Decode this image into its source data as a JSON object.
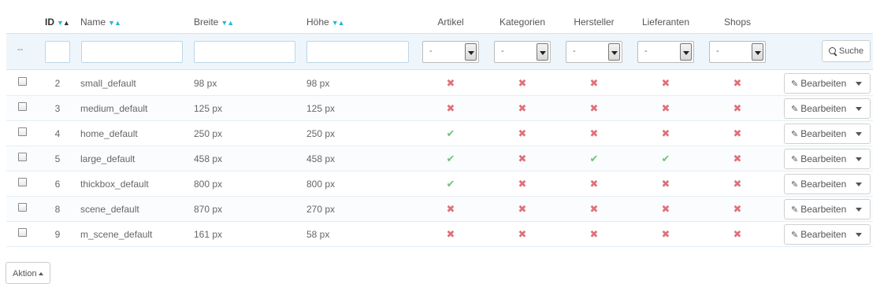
{
  "header": {
    "id": "ID",
    "name": "Name",
    "breite": "Breite",
    "hoehe": "Höhe",
    "artikel": "Artikel",
    "kategorien": "Kategorien",
    "hersteller": "Hersteller",
    "lieferanten": "Lieferanten",
    "shops": "Shops"
  },
  "filter": {
    "dash": "--",
    "select_value": "-",
    "search_label": "Suche"
  },
  "rows": [
    {
      "id": "2",
      "name": "small_default",
      "breite": "98 px",
      "hoehe": "98 px",
      "artikel": false,
      "kategorien": false,
      "hersteller": false,
      "lieferanten": false,
      "shops": false
    },
    {
      "id": "3",
      "name": "medium_default",
      "breite": "125 px",
      "hoehe": "125 px",
      "artikel": false,
      "kategorien": false,
      "hersteller": false,
      "lieferanten": false,
      "shops": false
    },
    {
      "id": "4",
      "name": "home_default",
      "breite": "250 px",
      "hoehe": "250 px",
      "artikel": true,
      "kategorien": false,
      "hersteller": false,
      "lieferanten": false,
      "shops": false
    },
    {
      "id": "5",
      "name": "large_default",
      "breite": "458 px",
      "hoehe": "458 px",
      "artikel": true,
      "kategorien": false,
      "hersteller": true,
      "lieferanten": true,
      "shops": false
    },
    {
      "id": "6",
      "name": "thickbox_default",
      "breite": "800 px",
      "hoehe": "800 px",
      "artikel": true,
      "kategorien": false,
      "hersteller": false,
      "lieferanten": false,
      "shops": false
    },
    {
      "id": "8",
      "name": "scene_default",
      "breite": "870 px",
      "hoehe": "270 px",
      "artikel": false,
      "kategorien": false,
      "hersteller": false,
      "lieferanten": false,
      "shops": false
    },
    {
      "id": "9",
      "name": "m_scene_default",
      "breite": "161 px",
      "hoehe": "58 px",
      "artikel": false,
      "kategorien": false,
      "hersteller": false,
      "lieferanten": false,
      "shops": false
    }
  ],
  "row_action": {
    "edit_label": "Bearbeiten"
  },
  "bulk": {
    "action_label": "Aktion"
  },
  "icons": {
    "yes": "check-icon",
    "no": "cross-icon"
  },
  "colors": {
    "yes": "#72c279",
    "no": "#e0707a",
    "sort_active": "#25b9d7",
    "filter_bg": "#eef6fc"
  }
}
